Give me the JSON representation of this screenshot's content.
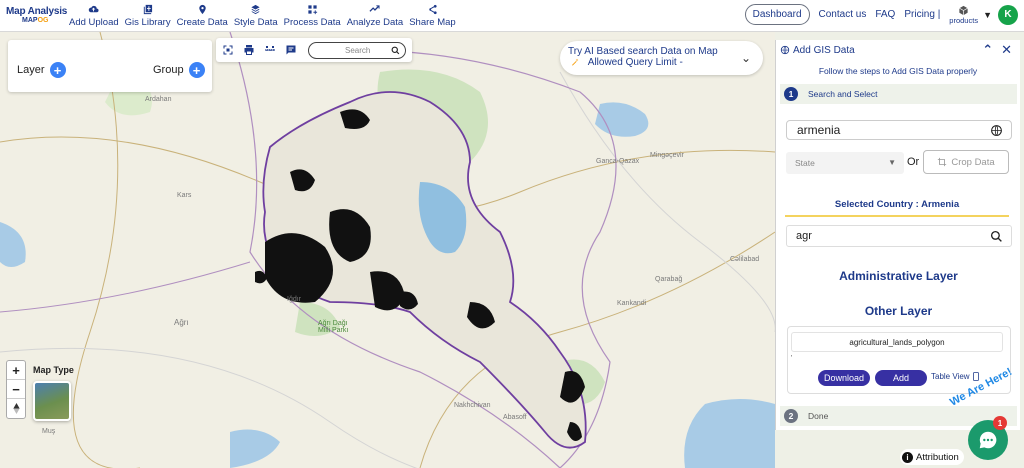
{
  "app": {
    "logo_line1": "Map Analysis",
    "logo_line2a": "MAP",
    "logo_line2b": "OG"
  },
  "nav": [
    {
      "label": "Add Upload",
      "icon": "upload-icon"
    },
    {
      "label": "Gis Library",
      "icon": "library-icon"
    },
    {
      "label": "Create Data",
      "icon": "location-pin-icon"
    },
    {
      "label": "Style Data",
      "icon": "style-icon"
    },
    {
      "label": "Process Data",
      "icon": "process-icon"
    },
    {
      "label": "Analyze Data",
      "icon": "analyze-icon"
    },
    {
      "label": "Share Map",
      "icon": "share-icon"
    }
  ],
  "topright": {
    "dashboard": "Dashboard",
    "contact": "Contact us",
    "faq": "FAQ",
    "pricing": "Pricing |",
    "products": "products",
    "avatar": "K"
  },
  "layer_panel": {
    "layer_label": "Layer",
    "group_label": "Group"
  },
  "map_tools": {
    "search_placeholder": "Search"
  },
  "ai_box": {
    "line1": "Try AI Based search Data on Map",
    "line2": "Allowed Query Limit -"
  },
  "map": {
    "map_type_label": "Map Type",
    "zoom_in": "+",
    "zoom_out": "−",
    "attribution": "Attribution",
    "places": [
      "Ardahan",
      "Kars",
      "Iğdır",
      "Ağrı Dağı Milli Parkı",
      "Ağrı",
      "Muş",
      "Nakhchivan",
      "Abasoff",
      "Ganca-Qazax",
      "Mingəçevir",
      "Kankandi",
      "Cəlilabad",
      "Qarabağ"
    ]
  },
  "panel": {
    "title": "Add GIS Data",
    "subtitle": "Follow the steps to Add GIS Data properly",
    "step1_num": "1",
    "step1_label": "Search and Select",
    "country_value": "armenia",
    "state_placeholder": "State",
    "or_label": "Or",
    "crop_label": "Crop Data",
    "selected_country": "Selected Country : Armenia",
    "layer_search_value": "agr",
    "admin_layer": "Administrative Layer",
    "other_layer": "Other Layer",
    "result_name": "agricultural_lands_polygon",
    "result_mark": "'",
    "download_label": "Download",
    "add_label": "Add",
    "table_view_label": "Table View",
    "step2_num": "2",
    "step2_label": "Done"
  },
  "chat": {
    "badge": "1",
    "tagline": "We Are Here!"
  },
  "colors": {
    "brand": "#1e3a8a",
    "accent": "#3b82f6",
    "button": "#3730a3",
    "chat": "#1b9a6c"
  }
}
